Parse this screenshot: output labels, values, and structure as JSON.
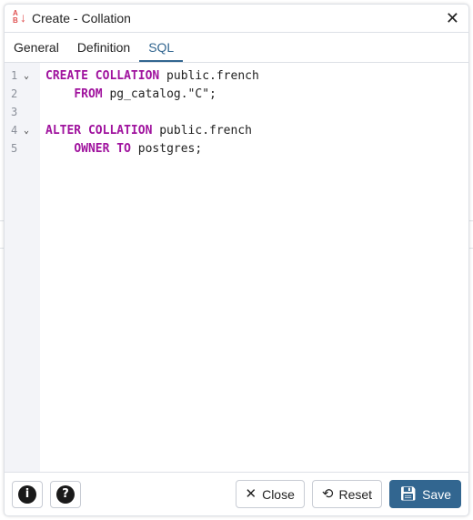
{
  "dialog": {
    "title": "Create - Collation",
    "title_icon": "sort-alpha-icon",
    "close_icon": "close-icon"
  },
  "tabs": [
    {
      "label": "General",
      "active": false
    },
    {
      "label": "Definition",
      "active": false
    },
    {
      "label": "SQL",
      "active": true
    }
  ],
  "editor": {
    "lines": [
      {
        "num": "1",
        "fold": true,
        "parts": [
          {
            "t": "CREATE COLLATION",
            "kw": true
          },
          {
            "t": " public.french",
            "kw": false
          }
        ]
      },
      {
        "num": "2",
        "fold": false,
        "parts": [
          {
            "t": "    ",
            "kw": false
          },
          {
            "t": "FROM",
            "kw": true
          },
          {
            "t": " pg_catalog.\"C\";",
            "kw": false
          }
        ]
      },
      {
        "num": "3",
        "fold": false,
        "parts": []
      },
      {
        "num": "4",
        "fold": true,
        "parts": [
          {
            "t": "ALTER COLLATION",
            "kw": true
          },
          {
            "t": " public.french",
            "kw": false
          }
        ]
      },
      {
        "num": "5",
        "fold": false,
        "parts": [
          {
            "t": "    ",
            "kw": false
          },
          {
            "t": "OWNER TO",
            "kw": true
          },
          {
            "t": " postgres;",
            "kw": false
          }
        ]
      }
    ]
  },
  "footer": {
    "info_icon": "info-icon",
    "help_icon": "help-icon",
    "close_label": "Close",
    "reset_label": "Reset",
    "save_label": "Save"
  },
  "colors": {
    "accent": "#326690",
    "keyword": "#a0139e",
    "title_icon": "#e05252"
  }
}
